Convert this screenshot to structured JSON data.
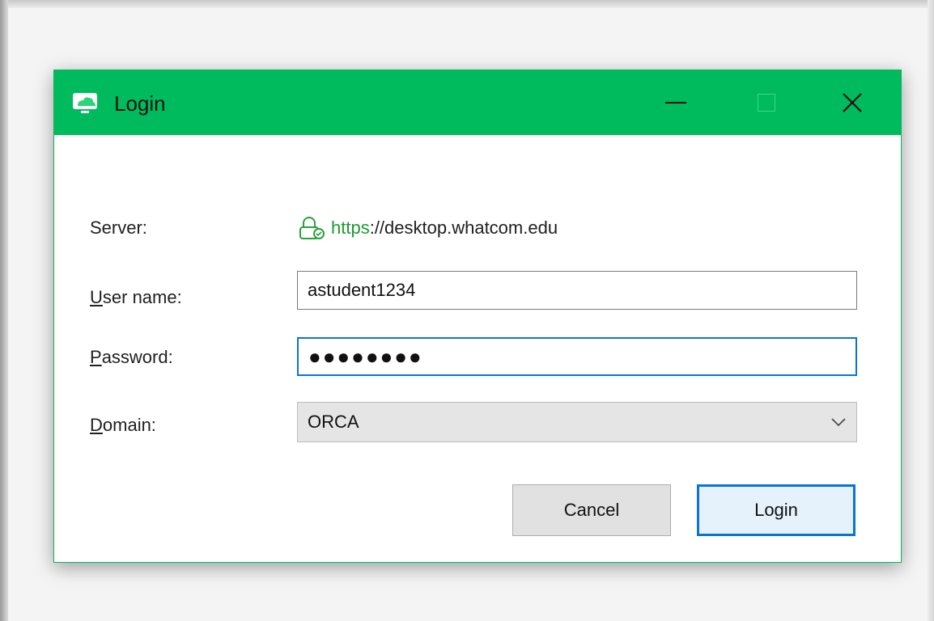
{
  "window": {
    "title": "Login",
    "app_icon": "monitor-cloud-icon",
    "controls": {
      "minimize_icon": "minimize-icon",
      "maximize_icon": "maximize-icon",
      "close_icon": "close-icon",
      "close_glyph": "✕"
    }
  },
  "form": {
    "server": {
      "label": "Server:",
      "scheme": "https",
      "rest": "://desktop.whatcom.edu",
      "icon": "secure-lock-icon"
    },
    "username": {
      "label_accel": "U",
      "label_rest": "ser name:",
      "value": "astudent1234"
    },
    "password": {
      "label_accel": "P",
      "label_rest": "assword:",
      "value": "●●●●●●●●"
    },
    "domain": {
      "label_accel": "D",
      "label_rest": "omain:",
      "value": "ORCA"
    }
  },
  "buttons": {
    "cancel": "Cancel",
    "login": "Login"
  },
  "colors": {
    "titlebar": "#00bb5e",
    "accent": "#0a74d1",
    "secure_text": "#1a9a2e"
  }
}
